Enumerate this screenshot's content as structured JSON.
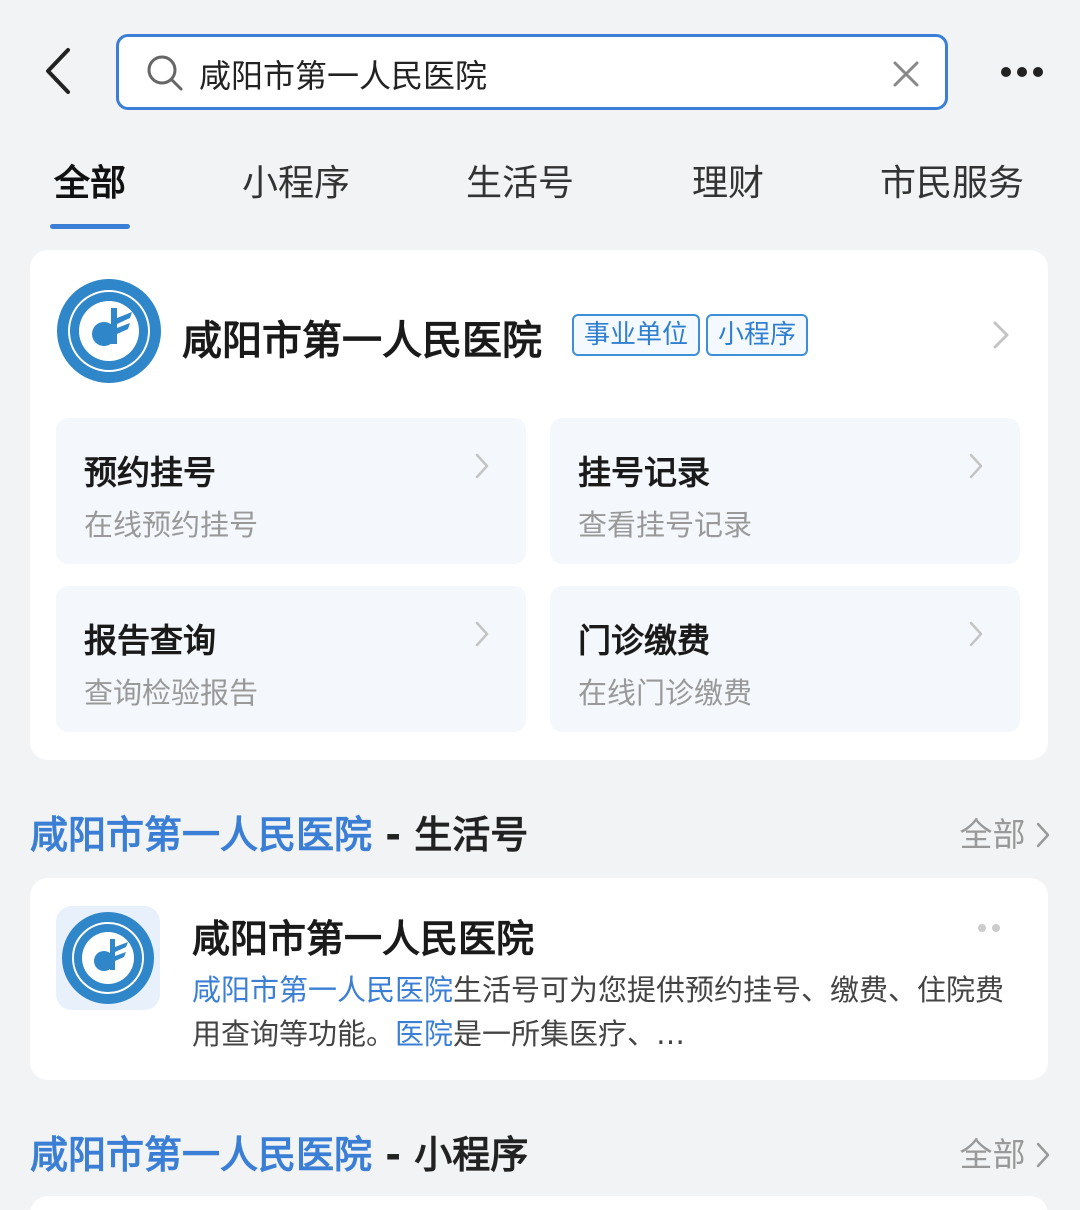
{
  "search": {
    "query": "咸阳市第一人民医院"
  },
  "tabs": [
    "全部",
    "小程序",
    "生活号",
    "理财",
    "市民服务"
  ],
  "main_card": {
    "title": "咸阳市第一人民医院",
    "tags": [
      "事业单位",
      "小程序"
    ],
    "services": [
      {
        "title": "预约挂号",
        "subtitle": "在线预约挂号"
      },
      {
        "title": "挂号记录",
        "subtitle": "查看挂号记录"
      },
      {
        "title": "报告查询",
        "subtitle": "查询检验报告"
      },
      {
        "title": "门诊缴费",
        "subtitle": "在线门诊缴费"
      }
    ]
  },
  "life_section": {
    "title": "咸阳市第一人民医院",
    "suffix": " - 生活号",
    "more": "全部",
    "item": {
      "title": "咸阳市第一人民医院",
      "desc_hl1": "咸阳市第一人民医院",
      "desc_part1": "生活号可为您提供预约挂号、缴费、住院费用查询等功能。",
      "desc_hl2": "医院",
      "desc_part2": "是一所集医疗、…"
    }
  },
  "mini_section": {
    "title": "咸阳市第一人民医院",
    "suffix": " - 小程序",
    "more": "全部"
  },
  "colors": {
    "accent": "#3a7fd5",
    "background": "#f2f3f5",
    "tile": "#f4f7fb"
  },
  "icons": [
    "back-icon",
    "search-icon",
    "clear-icon",
    "more-icon",
    "hospital-logo",
    "chevron-right-icon"
  ]
}
